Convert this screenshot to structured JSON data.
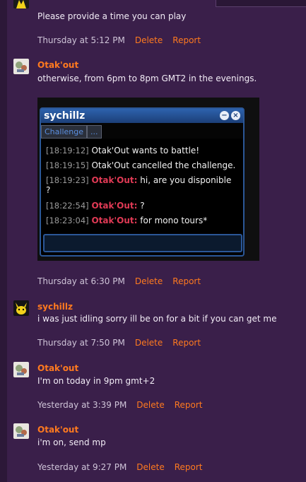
{
  "comments": [
    {
      "message": "Please provide a time you can play",
      "time": "Thursday at 5:12 PM",
      "delete_label": "Delete",
      "report_label": "Report"
    },
    {
      "username": "Otak'out",
      "message": "otherwise, from 6pm to 8pm GMT2 in the evenings.",
      "time": "Thursday at 6:30 PM",
      "delete_label": "Delete",
      "report_label": "Report",
      "attachment": {
        "window_title": "sychillz",
        "tabs": [
          "Challenge",
          "..."
        ],
        "lines": [
          {
            "timestamp": "[18:19:12]",
            "text": "Otak'Out wants to battle!"
          },
          {
            "timestamp": "[18:19:15]",
            "text": "Otak'Out cancelled the challenge."
          },
          {
            "timestamp": "[18:19:23]",
            "speaker": "Otak'Out:",
            "text": "hi, are you disponible",
            "text_cont": "?"
          },
          {
            "timestamp": "[18:22:54]",
            "speaker": "Otak'Out:",
            "text": "?"
          },
          {
            "timestamp": "[18:23:04]",
            "speaker": "Otak'Out:",
            "text": "for mono tours*"
          }
        ]
      }
    },
    {
      "username": "sychillz",
      "message": "i was just idling sorry ill be on for a bit if you can get me",
      "time": "Thursday at 7:50 PM",
      "delete_label": "Delete",
      "report_label": "Report"
    },
    {
      "username": "Otak'out",
      "message": "I'm on today in 9pm gmt+2",
      "time": "Yesterday at 3:39 PM",
      "delete_label": "Delete",
      "report_label": "Report"
    },
    {
      "username": "Otak'out",
      "message": "i'm on, send mp",
      "time": "Yesterday at 9:27 PM",
      "delete_label": "Delete",
      "report_label": "Report"
    }
  ],
  "colors": {
    "background": "#3a1f4a",
    "username": "#ff7a1f",
    "action_link": "#ff7a1f",
    "chat_speaker": "#e03a55",
    "chat_frame": "#2b5797"
  }
}
